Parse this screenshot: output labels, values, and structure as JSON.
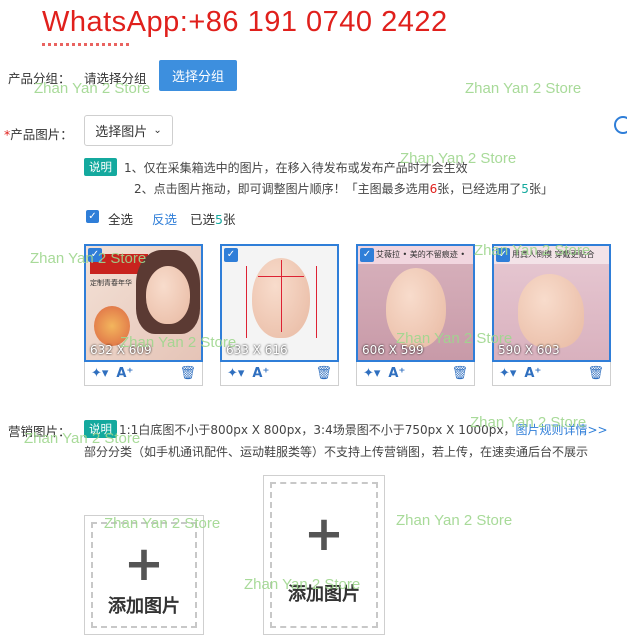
{
  "banner": {
    "text": "WhatsApp:+86 191 0740 2422"
  },
  "group": {
    "label": "产品分组：",
    "value": "请选择分组",
    "button": "选择分组"
  },
  "images": {
    "required_mark": "*",
    "label": "产品图片：",
    "select_button": "选择图片",
    "hint_tag": "说明",
    "hint_line1": "1、仅在采集箱选中的图片，在移入待发布或发布产品时才会生效",
    "hint_line2_a": "2、点击图片拖动，即可调整图片顺序！「主图最多选用",
    "hint_line2_max": "6",
    "hint_line2_b": "张，已经选用了",
    "hint_line2_used": "5",
    "hint_line2_c": "张」",
    "select_all": "全选",
    "invert": "反选",
    "selected_prefix": "已选",
    "selected_count": "5",
    "selected_suffix": "张",
    "cards": [
      {
        "dims": "632 X 609",
        "caption": "定制青春年华"
      },
      {
        "dims": "633 X 616",
        "caption": ""
      },
      {
        "dims": "606 X 599",
        "caption": "艾薇拉 • 美的不留痕迹 •"
      },
      {
        "dims": "590 X 603",
        "caption": "用真人倒模 穿戴更贴合"
      }
    ],
    "tool_icons": [
      "magic-wand-icon",
      "ai-icon",
      "trash-icon"
    ]
  },
  "marketing": {
    "label": "营销图片：",
    "hint_tag": "说明",
    "hint_line1": "1:1白底图不小于800px X 800px，3:4场景图不小于750px X 1000px，",
    "rules_link": "图片规则详情>>",
    "hint_line2": "部分分类（如手机通讯配件、运动鞋服类等）不支持上传营销图，若上传，在速卖通后台不展示",
    "add_1": "添加图片",
    "add_2": "添加图片"
  },
  "watermark": "Zhan Yan 2 Store",
  "colors": {
    "accent": "#3d8fde",
    "tag": "#14a99e",
    "danger": "#e0201c",
    "watermark": "#9fd78e"
  }
}
